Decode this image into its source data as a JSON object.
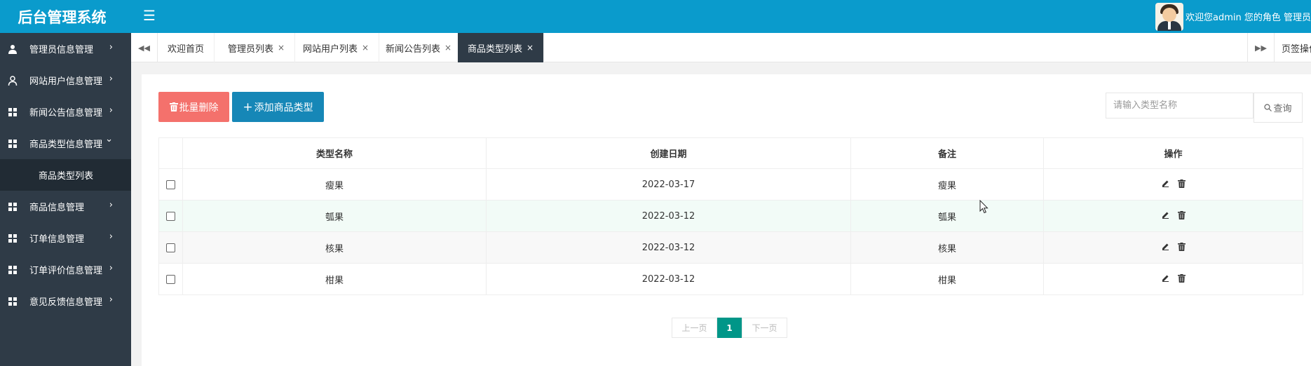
{
  "app": {
    "title": "后台管理系统"
  },
  "header": {
    "menu_icon": "hamburger-icon",
    "user_text": "欢迎您admin 您的角色 管理员"
  },
  "sidebar": {
    "items": [
      {
        "label": "管理员信息管理",
        "icon": "user-group-icon",
        "arrow": "›"
      },
      {
        "label": "网站用户信息管理",
        "icon": "user-icon",
        "arrow": "›"
      },
      {
        "label": "新闻公告信息管理",
        "icon": "grid-icon",
        "arrow": "›"
      },
      {
        "label": "商品类型信息管理",
        "icon": "grid-icon",
        "arrow": "⌄"
      },
      {
        "label": "商品信息管理",
        "icon": "grid-icon",
        "arrow": "›"
      },
      {
        "label": "订单信息管理",
        "icon": "grid-icon",
        "arrow": "›"
      },
      {
        "label": "订单评价信息管理",
        "icon": "grid-icon",
        "arrow": "›"
      },
      {
        "label": "意见反馈信息管理",
        "icon": "grid-icon",
        "arrow": "›"
      }
    ],
    "sub_items": [
      {
        "label": "商品类型列表"
      }
    ]
  },
  "tabs": {
    "left_icon": "double-left-icon",
    "right_icon": "double-right-icon",
    "items": [
      {
        "label": "欢迎首页",
        "closable": false
      },
      {
        "label": "管理员列表",
        "close": "×"
      },
      {
        "label": "网站用户列表",
        "close": "×"
      },
      {
        "label": "新闻公告列表",
        "close": "×"
      },
      {
        "label": "商品类型列表",
        "close": "×",
        "active": true
      }
    ],
    "ops_label": "页签操作"
  },
  "toolbar": {
    "delete_label": "批量删除",
    "add_label": "添加商品类型",
    "search_placeholder": "请输入类型名称",
    "search_label": "查询"
  },
  "table": {
    "headers": [
      "类型名称",
      "创建日期",
      "备注",
      "操作"
    ],
    "rows": [
      {
        "name": "瘦果",
        "date": "2022-03-17",
        "note": "瘦果"
      },
      {
        "name": "瓠果",
        "date": "2022-03-12",
        "note": "瓠果"
      },
      {
        "name": "核果",
        "date": "2022-03-12",
        "note": "核果"
      },
      {
        "name": "柑果",
        "date": "2022-03-12",
        "note": "柑果"
      }
    ]
  },
  "pagination": {
    "prev": "上一页",
    "current": "1",
    "next": "下一页"
  },
  "colors": {
    "header": "#0a9bcc",
    "sidebar": "#2f3b47",
    "danger": "#f4716c",
    "primary": "#1687b7",
    "pager_active": "#009688"
  }
}
